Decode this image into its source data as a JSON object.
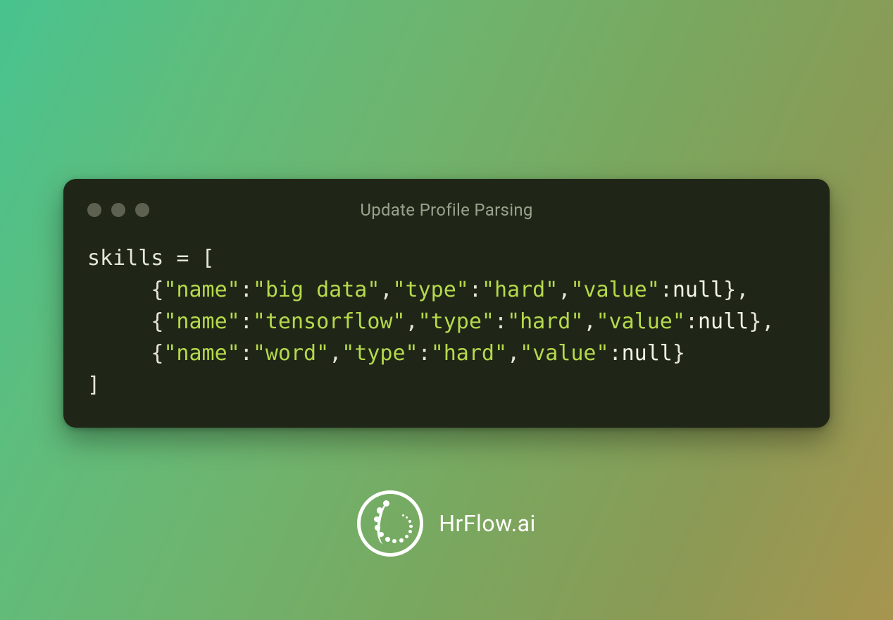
{
  "window": {
    "title": "Update Profile Parsing"
  },
  "code": {
    "var_name": "skills",
    "items": [
      {
        "name": "big data",
        "type": "hard",
        "value": null
      },
      {
        "name": "tensorflow",
        "type": "hard",
        "value": null
      },
      {
        "name": "word",
        "type": "hard",
        "value": null
      }
    ]
  },
  "brand": {
    "name": "HrFlow.ai"
  },
  "colors": {
    "window_bg": "#1f2617",
    "title_fg": "#9aa18b",
    "dot_fg": "#5d6150",
    "code_default": "#e6e6d8",
    "code_key_string": "#b6d94c",
    "brand_fg": "#ffffff"
  }
}
